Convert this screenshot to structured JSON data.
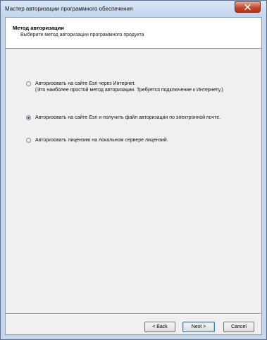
{
  "window": {
    "title": "Мастер авторизации программного обеспечения"
  },
  "header": {
    "title": "Метод авторизации",
    "subtitle": "Выберите метод авторизации программного продукта"
  },
  "options": [
    {
      "line1": "Авторизовать на сайте Esri через Интернет.",
      "line2": "(Это наиболее простой метод авторизации. Требуется подключение к Интернету.)",
      "checked": false
    },
    {
      "line1": "Авторизовать на сайте Esri и получить файл авторизации по электронной почте.",
      "checked": true
    },
    {
      "line1": "Авторизовать лицензию на локальном сервере лицензий.",
      "checked": false
    }
  ],
  "buttons": {
    "back": "< Back",
    "next": "Next >",
    "cancel": "Cancel"
  }
}
